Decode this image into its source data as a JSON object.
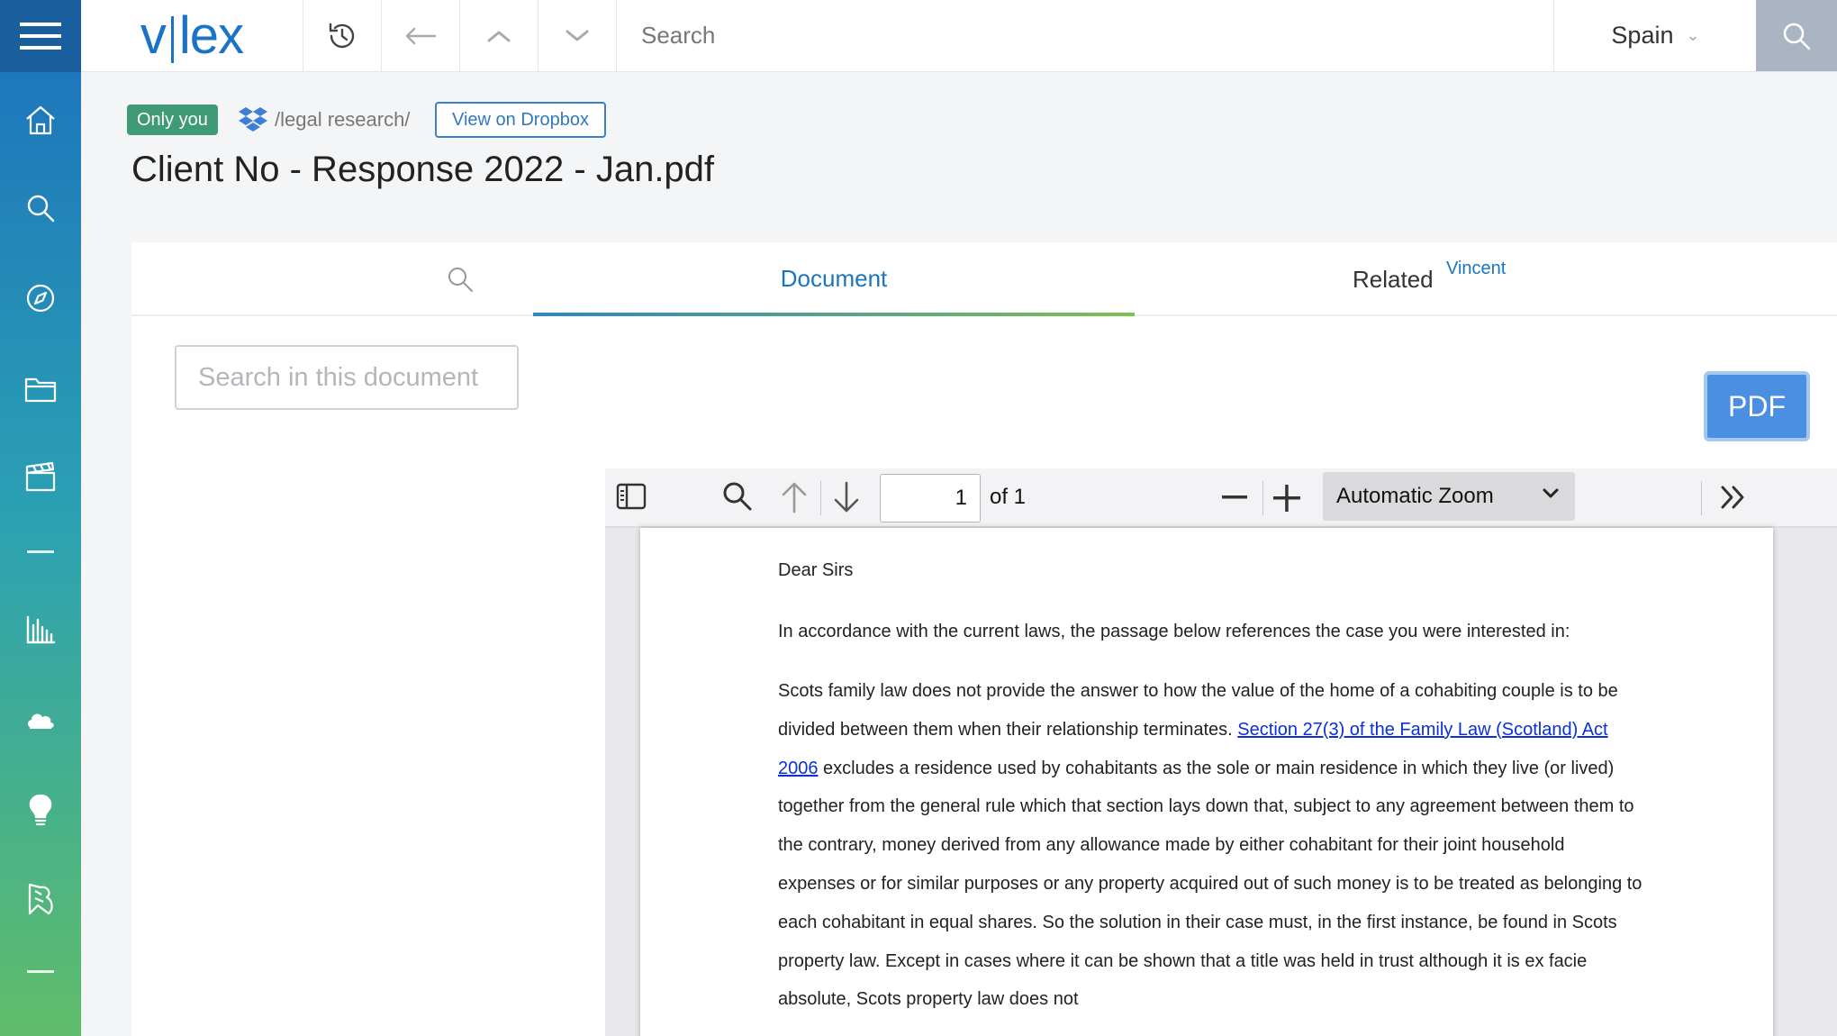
{
  "app": {
    "logo_left": "v",
    "logo_right": "lex"
  },
  "header": {
    "search_placeholder": "Search",
    "country": "Spain"
  },
  "sidebar": {
    "items": [
      {
        "icon": "home-icon"
      },
      {
        "icon": "search-icon"
      },
      {
        "icon": "compass-icon"
      },
      {
        "icon": "folder-icon"
      },
      {
        "icon": "clapperboard-icon"
      },
      {
        "icon": "bar-chart-icon"
      },
      {
        "icon": "cloud-icon"
      },
      {
        "icon": "lightbulb-icon"
      },
      {
        "icon": "vincent-icon"
      }
    ]
  },
  "document": {
    "visibility_badge": "Only you",
    "folder_path": "/legal research/",
    "view_on_dropbox": "View on Dropbox",
    "title": "Client No - Response 2022 - Jan.pdf"
  },
  "tabs": {
    "document": "Document",
    "related": "Related",
    "related_user": "Vincent"
  },
  "doc_search_placeholder": "Search in this document",
  "pdf_button": "PDF",
  "pdf_viewer": {
    "page_number": "1",
    "page_count_label": "of 1",
    "zoom": "Automatic Zoom"
  },
  "pdf_content": {
    "salutation": "Dear Sirs",
    "intro": "In accordance with the current laws, the passage below references the case you were interested in:",
    "para_part1": "Scots family law does not provide the answer to how the value of the home of a cohabiting couple is to be divided between them when their relationship terminates. ",
    "link_text": "Section 27(3) of the Family Law (Scotland) Act 2006",
    "para_part2": " excludes a residence used by cohabitants as the sole or main residence in which they live (or lived) together from the general rule which that section lays down that, subject to any agreement between them to the contrary, money derived from any allowance made by either cohabitant for their joint household expenses or for similar purposes or any property acquired out of such money is to be treated as belonging to each cohabitant in equal shares. So the solution in their case must, in the first instance, be found in Scots property law. Except in cases where it can be shown that a title was held in trust although it is ex facie absolute, Scots property law does not"
  },
  "colors": {
    "sidebar_top": "#1b70bd",
    "sidebar_bottom": "#5fbd6a",
    "accent": "#1b75bc",
    "badge": "#3f9a75",
    "pdf_button": "#4a8fe0"
  }
}
